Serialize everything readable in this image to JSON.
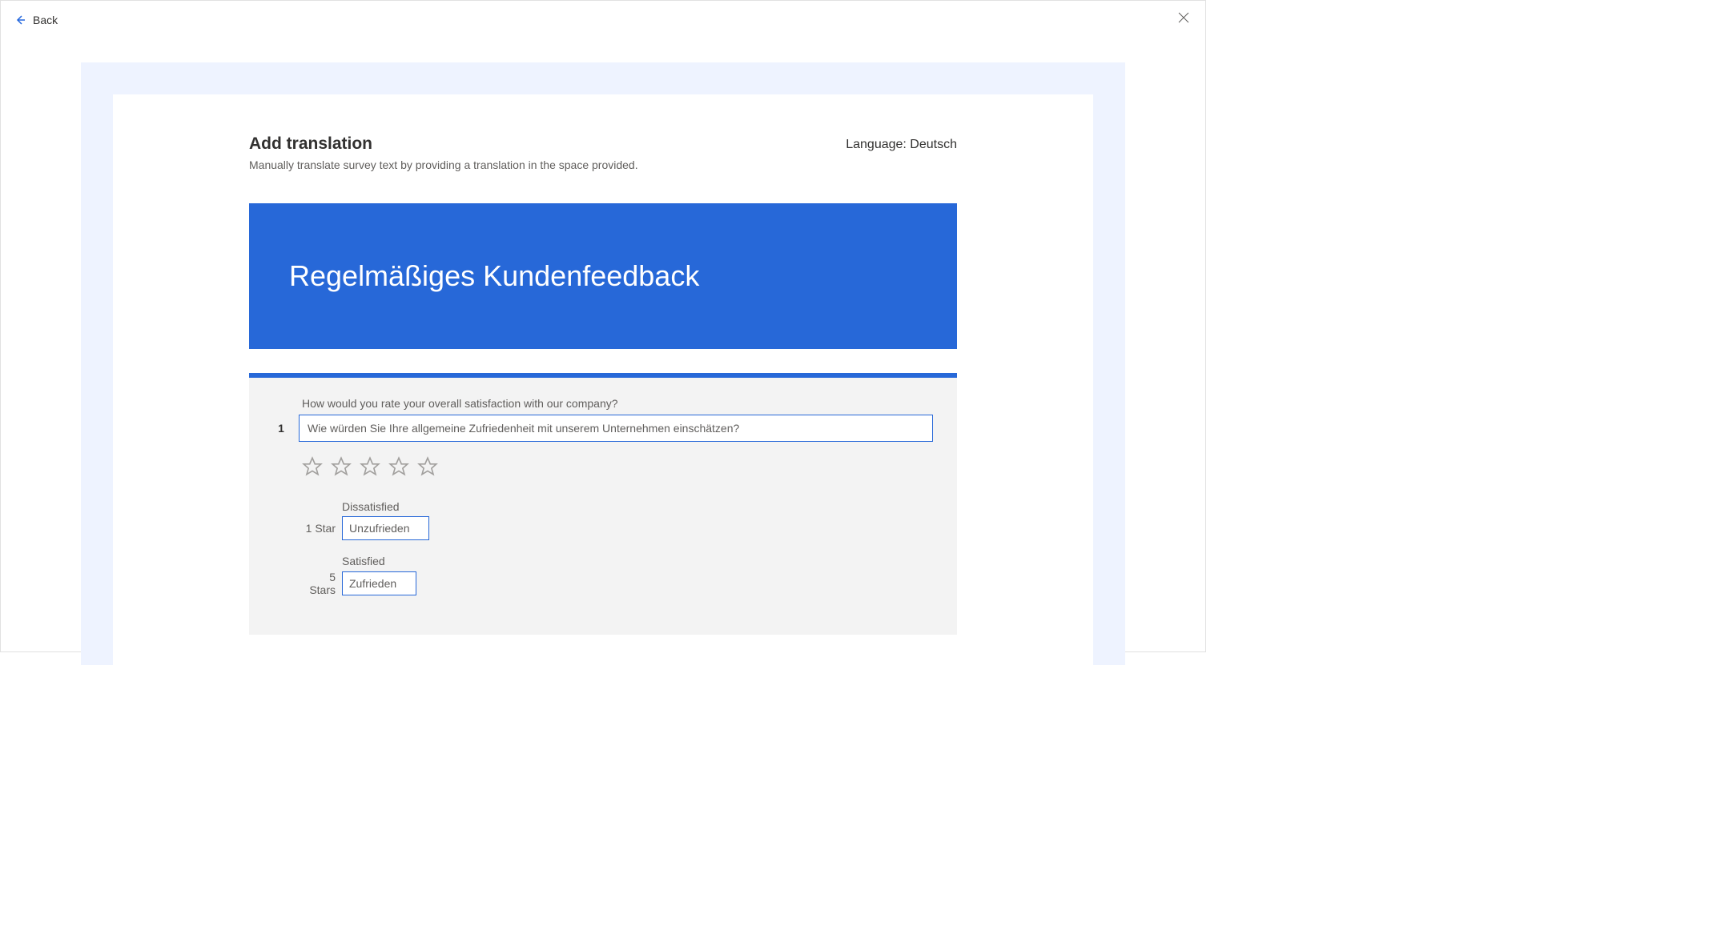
{
  "topbar": {
    "back_label": "Back"
  },
  "header": {
    "title": "Add translation",
    "subtitle": "Manually translate survey text by providing a translation in the space provided.",
    "language_prefix": "Language: ",
    "language_value": "Deutsch"
  },
  "banner": {
    "title": "Regelmäßiges Kundenfeedback"
  },
  "question": {
    "number": "1",
    "source_text": "How would you rate your overall satisfaction with our company?",
    "translation_value": "Wie würden Sie Ihre allgemeine Zufriedenheit mit unserem Unternehmen einschätzen?",
    "rating_labels": [
      {
        "prefix": "1 Star",
        "source": "Dissatisfied",
        "translation": "Unzufrieden"
      },
      {
        "prefix": "5 Stars",
        "source": "Satisfied",
        "translation": "Zufrieden"
      }
    ]
  }
}
